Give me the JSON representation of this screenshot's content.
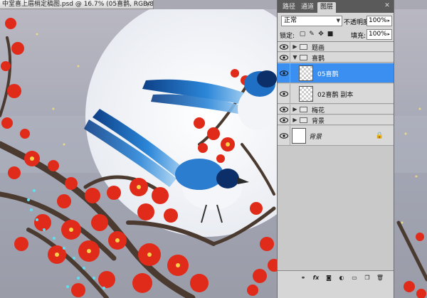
{
  "document": {
    "title": "中堂喜上眉梢定稿图.psd @ 16.7% (05喜鹊, RGB/8) *",
    "close_glyph": "×"
  },
  "panel": {
    "tabs": [
      {
        "label": "路径",
        "active": false
      },
      {
        "label": "通道",
        "active": false
      },
      {
        "label": "图层",
        "active": true
      }
    ],
    "blend_mode": "正常",
    "opacity_label": "不透明度:",
    "opacity_value": "100%",
    "lock_label": "锁定:",
    "fill_label": "填充:",
    "fill_value": "100%",
    "close_glyph": "✕",
    "menu_glyph": "▾≡"
  },
  "layers": [
    {
      "name": "题画",
      "kind": "group",
      "expanded": false,
      "visible": true,
      "selected": false
    },
    {
      "name": "喜鹊",
      "kind": "group",
      "expanded": true,
      "visible": true,
      "selected": false
    },
    {
      "name": "05喜鹊",
      "kind": "layer",
      "visible": true,
      "selected": true
    },
    {
      "name": "02喜鹊 副本",
      "kind": "layer",
      "visible": true,
      "selected": false
    },
    {
      "name": "梅花",
      "kind": "group",
      "expanded": false,
      "visible": true,
      "selected": false
    },
    {
      "name": "背景",
      "kind": "group",
      "expanded": false,
      "visible": true,
      "selected": false
    },
    {
      "name": "背景",
      "kind": "background",
      "visible": true,
      "selected": false,
      "locked": true
    }
  ],
  "footer_icons": [
    "link-icon",
    "fx-icon",
    "mask-icon",
    "adjustment-icon",
    "group-icon",
    "new-layer-icon",
    "trash-icon"
  ],
  "colors": {
    "selection": "#3b8ff0",
    "panel_bg": "#d6d6d6",
    "blossom": "#e02a1a",
    "magpie_blue": "#1f6fc4",
    "moon": "#f4f6f9"
  }
}
